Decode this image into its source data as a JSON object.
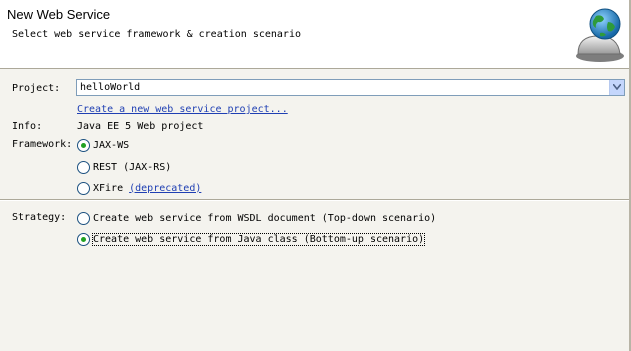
{
  "header": {
    "title": "New Web Service",
    "description": "Select web service framework & creation scenario",
    "graphic": "globe-bell-icon"
  },
  "project": {
    "label": "Project:",
    "value": "helloWorld",
    "create_link": "Create a new web service project..."
  },
  "info": {
    "label": "Info:",
    "value": "Java EE 5 Web project"
  },
  "framework": {
    "label": "Framework:",
    "options": [
      {
        "label": "JAX-WS",
        "checked": true
      },
      {
        "label": "REST (JAX-RS)",
        "checked": false
      },
      {
        "label": "XFire",
        "checked": false,
        "link": "(deprecated)"
      }
    ]
  },
  "strategy": {
    "label": "Strategy:",
    "options": [
      {
        "label": "Create web service from WSDL document (Top-down scenario)",
        "checked": false
      },
      {
        "label": "Create web service from Java class (Bottom-up scenario)",
        "checked": true
      }
    ]
  },
  "colors": {
    "link": "#1f3fb3",
    "radio_dot": "#21a121",
    "background": "#f4f3ee"
  }
}
